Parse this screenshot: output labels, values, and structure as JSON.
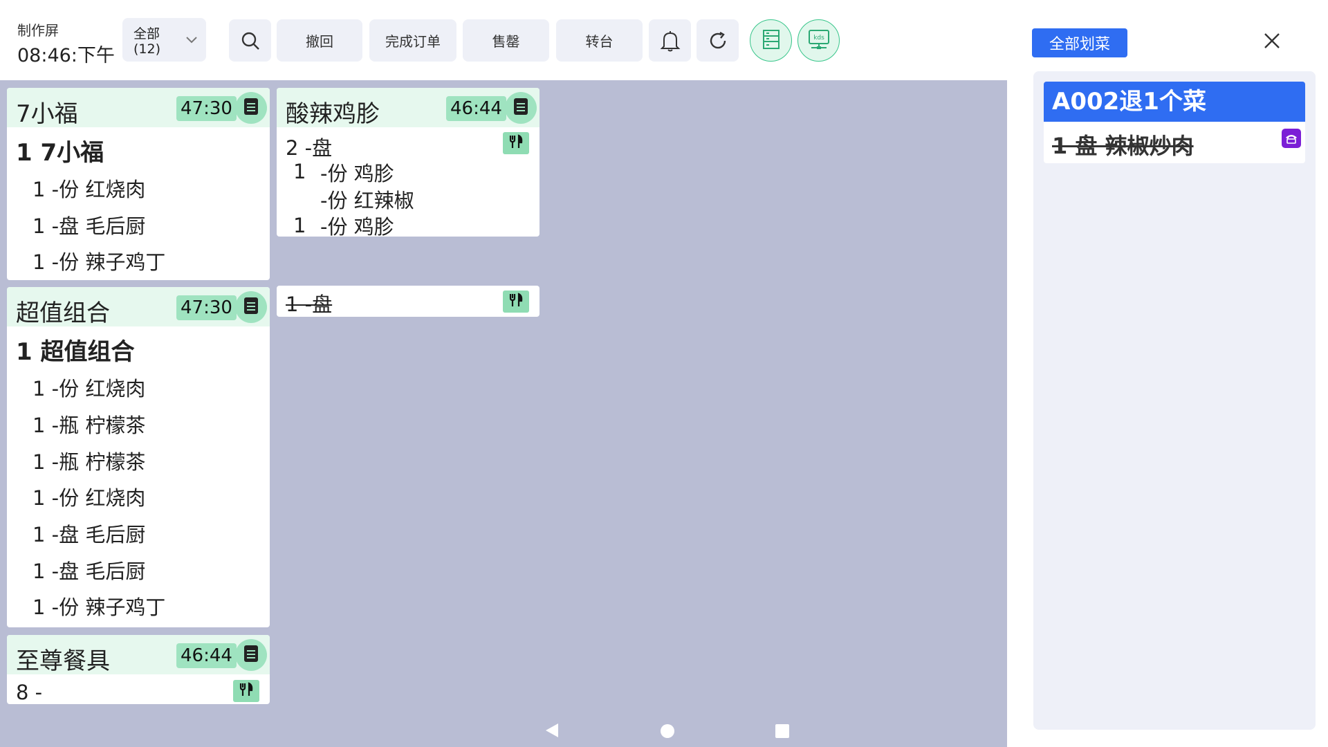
{
  "header": {
    "title": "制作屏",
    "time": "08:46:下午",
    "filter_line1": "全部",
    "filter_line2": "(12)",
    "undo_label": "撤回",
    "complete_label": "完成订单",
    "soldout_label": "售罄",
    "transfer_label": "转台"
  },
  "cards": {
    "c1": {
      "title": "7小福",
      "time": "47:30",
      "main": "1 7小福",
      "items": [
        "1 -份 红烧肉",
        "1 -盘 毛后厨",
        "1 -份 辣子鸡丁"
      ]
    },
    "c2": {
      "title": "超值组合",
      "time": "47:30",
      "main": "1 超值组合",
      "items": [
        "1 -份 红烧肉",
        "1 -瓶 柠檬茶",
        "1 -瓶 柠檬茶",
        "1 -份 红烧肉",
        "1 -盘 毛后厨",
        "1 -盘 毛后厨",
        "1 -份 辣子鸡丁"
      ]
    },
    "c3": {
      "title": "至尊餐具",
      "time": "46:44",
      "main": "8 -"
    },
    "c4": {
      "title": "酸辣鸡胗",
      "time": "46:44",
      "main": "2 -盘",
      "items": [
        {
          "qty": "1",
          "text": "-份 鸡胗"
        },
        {
          "qty": "",
          "text": "-份 红辣椒"
        },
        {
          "qty": "1",
          "text": "-份 鸡胗"
        }
      ]
    },
    "c5": {
      "main": "1 -盘"
    }
  },
  "right": {
    "all_label": "全部划菜",
    "card_title": "A002退1个菜",
    "card_line": "1 盘 辣椒炒肉"
  },
  "colors": {
    "accent_blue": "#2f6df2",
    "card_head_green": "#e6f8ee",
    "timer_green": "#9fe3c0",
    "board_bg": "#b9bdd4",
    "phone_purple": "#7b1fd6"
  }
}
